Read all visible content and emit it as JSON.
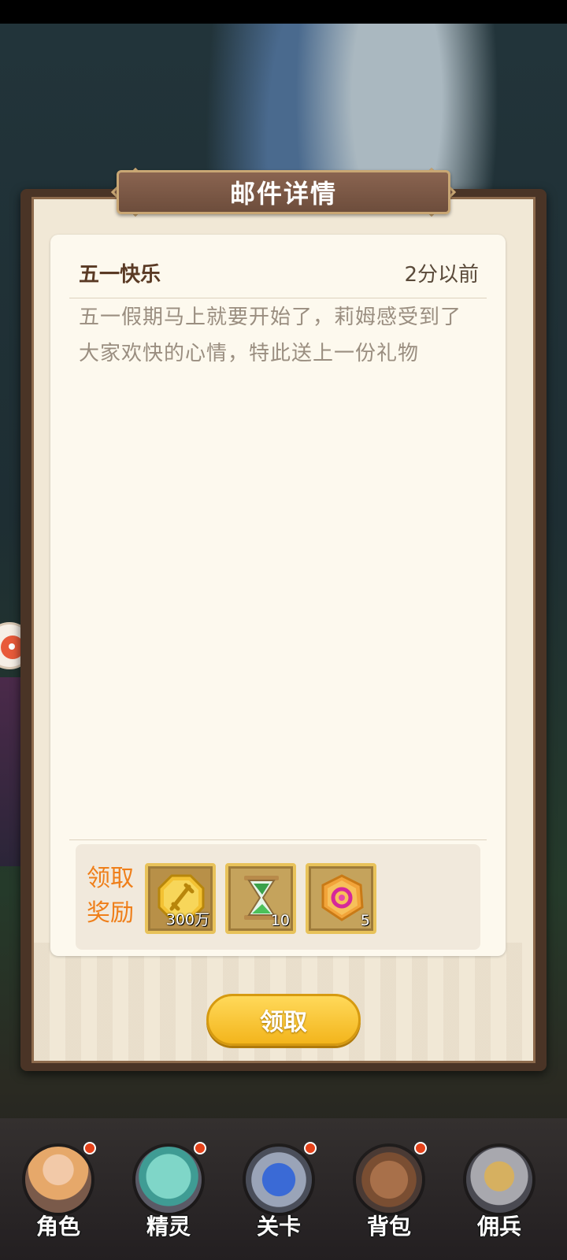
{
  "dialog": {
    "title": "邮件详情",
    "mail": {
      "subject": "五一快乐",
      "time": "2分以前",
      "body": "五一假期马上就要开始了，莉姆感受到了大家欢快的心情，特此送上一份礼物"
    },
    "rewards": {
      "label_line1": "领取",
      "label_line2": "奖励",
      "items": [
        {
          "icon": "gold-coin-sword-icon",
          "count": "300万"
        },
        {
          "icon": "hourglass-icon",
          "count": "10"
        },
        {
          "icon": "fire-gem-icon",
          "count": "5"
        }
      ]
    },
    "claim_button": "领取"
  },
  "nav": {
    "items": [
      {
        "label": "角色",
        "icon": "character-icon",
        "badge": true
      },
      {
        "label": "精灵",
        "icon": "slime-spirit-icon",
        "badge": true
      },
      {
        "label": "关卡",
        "icon": "stage-icon",
        "badge": true
      },
      {
        "label": "背包",
        "icon": "backpack-icon",
        "badge": true
      },
      {
        "label": "佣兵",
        "icon": "knight-helmet-icon",
        "badge": false
      }
    ]
  }
}
